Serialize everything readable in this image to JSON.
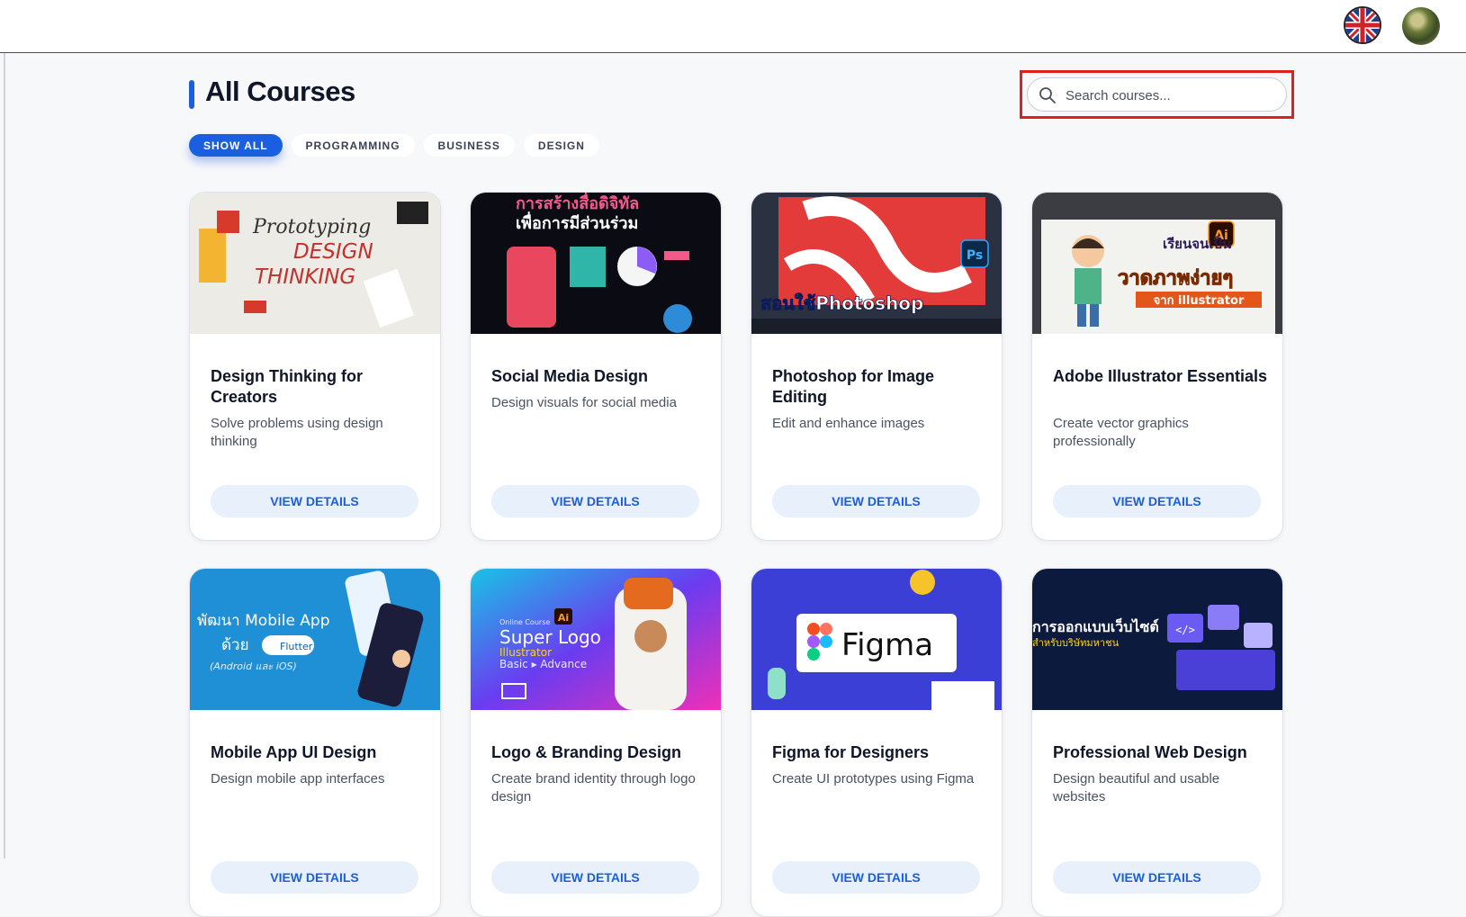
{
  "header": {
    "language_icon": "uk-flag-icon",
    "avatar_icon": "user-avatar"
  },
  "page": {
    "title": "All Courses"
  },
  "search": {
    "placeholder": "Search courses...",
    "value": ""
  },
  "filters": [
    {
      "label": "SHOW ALL",
      "active": true
    },
    {
      "label": "PROGRAMMING",
      "active": false
    },
    {
      "label": "BUSINESS",
      "active": false
    },
    {
      "label": "DESIGN",
      "active": false
    }
  ],
  "courses": [
    {
      "title": "Design Thinking for Creators",
      "description": "Solve problems using design thinking",
      "button": "VIEW DETAILS",
      "thumb_text": [
        "Prototyping",
        "DESIGN",
        "THINKING"
      ]
    },
    {
      "title": "Social Media Design",
      "description": "Design visuals for social media",
      "button": "VIEW DETAILS",
      "thumb_text": [
        "การสร้างสื่อดิจิทัล",
        "เพื่อการมีส่วนร่วม"
      ]
    },
    {
      "title": "Photoshop for Image Editing",
      "description": "Edit and enhance images",
      "button": "VIEW DETAILS",
      "thumb_text": [
        "สอนใช้Photoshop",
        "Ps"
      ]
    },
    {
      "title": "Adobe Illustrator Essentials",
      "description": "Create vector graphics professionally",
      "button": "VIEW DETAILS",
      "thumb_text": [
        "เรียนจนเป็น",
        "วาดภาพง่ายๆ",
        "จาก illustrator",
        "Ai"
      ]
    },
    {
      "title": "Mobile App UI Design",
      "description": "Design mobile app interfaces",
      "button": "VIEW DETAILS",
      "thumb_text": [
        "พัฒนา Mobile App",
        "ด้วย",
        "Flutter",
        "(Android และ iOS)"
      ]
    },
    {
      "title": "Logo & Branding Design",
      "description": "Create brand identity through logo design",
      "button": "VIEW DETAILS",
      "thumb_text": [
        "Online Course",
        "Super Logo",
        "Illustrator",
        "Basic ▸ Advance",
        "Ai"
      ]
    },
    {
      "title": "Figma for Designers",
      "description": "Create UI prototypes using Figma",
      "button": "VIEW DETAILS",
      "thumb_text": [
        "Figma"
      ]
    },
    {
      "title": "Professional Web Design",
      "description": "Design beautiful and usable websites",
      "button": "VIEW DETAILS",
      "thumb_text": [
        "การออกแบบเว็บไซต์",
        "สำหรับบริษัทมหาชน",
        "</>"
      ]
    }
  ],
  "colors": {
    "primary": "#1a5fe0",
    "highlight": "#e01f1f",
    "button_bg": "#e8f0fb"
  }
}
